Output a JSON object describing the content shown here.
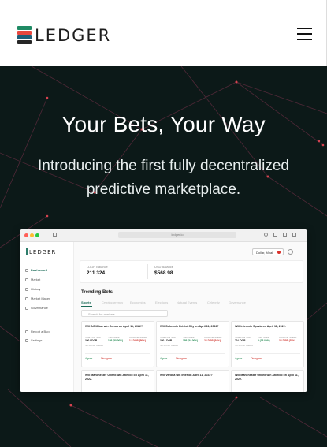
{
  "header": {
    "brand": "LEDGER",
    "brand_colors": [
      "#1f8a64",
      "#e8473f",
      "#1e5f7a",
      "#262626"
    ],
    "menu_icon": "hamburger-icon"
  },
  "hero": {
    "title": "Your Bets, Your Way",
    "subtitle": "Introducing the first fully decentralized predictive marketplace."
  },
  "preview": {
    "url": "ledger.io",
    "logo": "LEDGER",
    "user_chip": "Dollar, Mbali",
    "sidebar": {
      "items": [
        "Dashboard",
        "Market",
        "History",
        "Market Maker",
        "Governance"
      ],
      "bottom_items": [
        "Report a Bug",
        "Settings"
      ]
    },
    "balances": {
      "ledger_label": "LDGR Balance",
      "ledger_value": "211.324",
      "usd_label": "USD Balance",
      "usd_value": "$568.98"
    },
    "trending_title": "Trending Bets",
    "tabs": [
      "Sports",
      "Cryptocurrency",
      "Economics",
      "Elections",
      "Natural Events",
      "Celebrity",
      "Governance"
    ],
    "search_placeholder": "Search for markets",
    "cards_top": [
      {
        "question": "Will AC Milan win Genoa on April 11, 2022?",
        "pool": "390 LDGR",
        "stake": "195 (50.00%)",
        "outcome": "1 LDGR (50%)"
      },
      {
        "question": "Will Duke win Bristol City on April 11, 2022?",
        "pool": "350 LDGR",
        "stake": "195 (54.00%)",
        "outcome": "2 LDGR (54%)"
      },
      {
        "question": "Will Inter win Spezia on April 11, 2022.",
        "pool": "70 LDGR",
        "stake": "5 (35.00%)",
        "outcome": "3 LDGR (35%)"
      }
    ],
    "cards_bottom": [
      "Will Manchester United win Atletico on April 11, 2022.",
      "Will Verona win Inter on April 11, 2022?",
      "Will Manchester United win Atletico on April 11, 2022."
    ],
    "card_stat_labels": [
      "Total Pool Size",
      "Your Stake",
      "Outcome Staked"
    ],
    "card_note": "No further staked",
    "agree_label": "Agree",
    "disagree_label": "Disagree"
  }
}
